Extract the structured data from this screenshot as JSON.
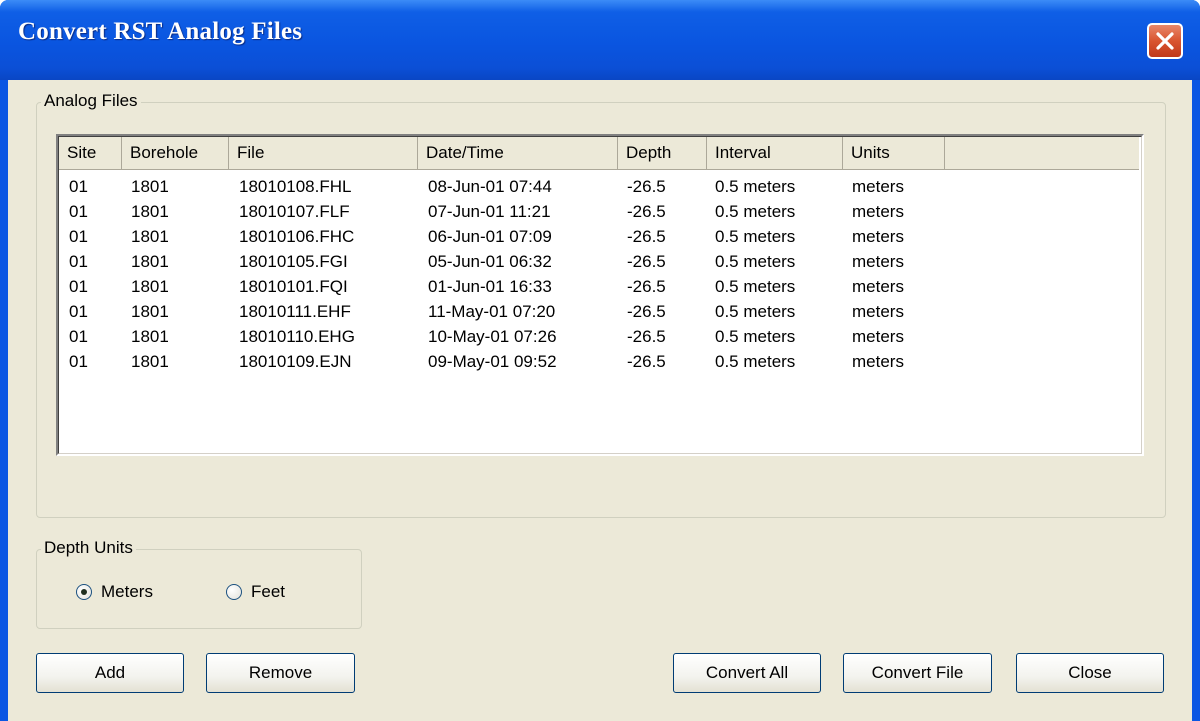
{
  "window": {
    "title": "Convert RST Analog Files"
  },
  "analog_files": {
    "label": "Analog Files",
    "columns": [
      "Site",
      "Borehole",
      "File",
      "Date/Time",
      "Depth",
      "Interval",
      "Units"
    ],
    "rows": [
      [
        "01",
        "1801",
        "18010108.FHL",
        "08-Jun-01 07:44",
        "-26.5",
        "0.5 meters",
        "meters"
      ],
      [
        "01",
        "1801",
        "18010107.FLF",
        "07-Jun-01 11:21",
        "-26.5",
        "0.5 meters",
        "meters"
      ],
      [
        "01",
        "1801",
        "18010106.FHC",
        "06-Jun-01 07:09",
        "-26.5",
        "0.5 meters",
        "meters"
      ],
      [
        "01",
        "1801",
        "18010105.FGI",
        "05-Jun-01 06:32",
        "-26.5",
        "0.5 meters",
        "meters"
      ],
      [
        "01",
        "1801",
        "18010101.FQI",
        "01-Jun-01 16:33",
        "-26.5",
        "0.5 meters",
        "meters"
      ],
      [
        "01",
        "1801",
        "18010111.EHF",
        "11-May-01 07:20",
        "-26.5",
        "0.5 meters",
        "meters"
      ],
      [
        "01",
        "1801",
        "18010110.EHG",
        "10-May-01 07:26",
        "-26.5",
        "0.5 meters",
        "meters"
      ],
      [
        "01",
        "1801",
        "18010109.EJN",
        "09-May-01 09:52",
        "-26.5",
        "0.5 meters",
        "meters"
      ]
    ]
  },
  "depth_units": {
    "label": "Depth Units",
    "options": [
      "Meters",
      "Feet"
    ],
    "selected": "Meters"
  },
  "buttons": {
    "add": "Add",
    "remove": "Remove",
    "convert_all": "Convert All",
    "convert_file": "Convert File",
    "close": "Close"
  },
  "icons": {
    "close": "close-x-icon"
  },
  "colors": {
    "titlebar": "#0a55e0",
    "close_button": "#d9542f",
    "face": "#ece9d8"
  }
}
